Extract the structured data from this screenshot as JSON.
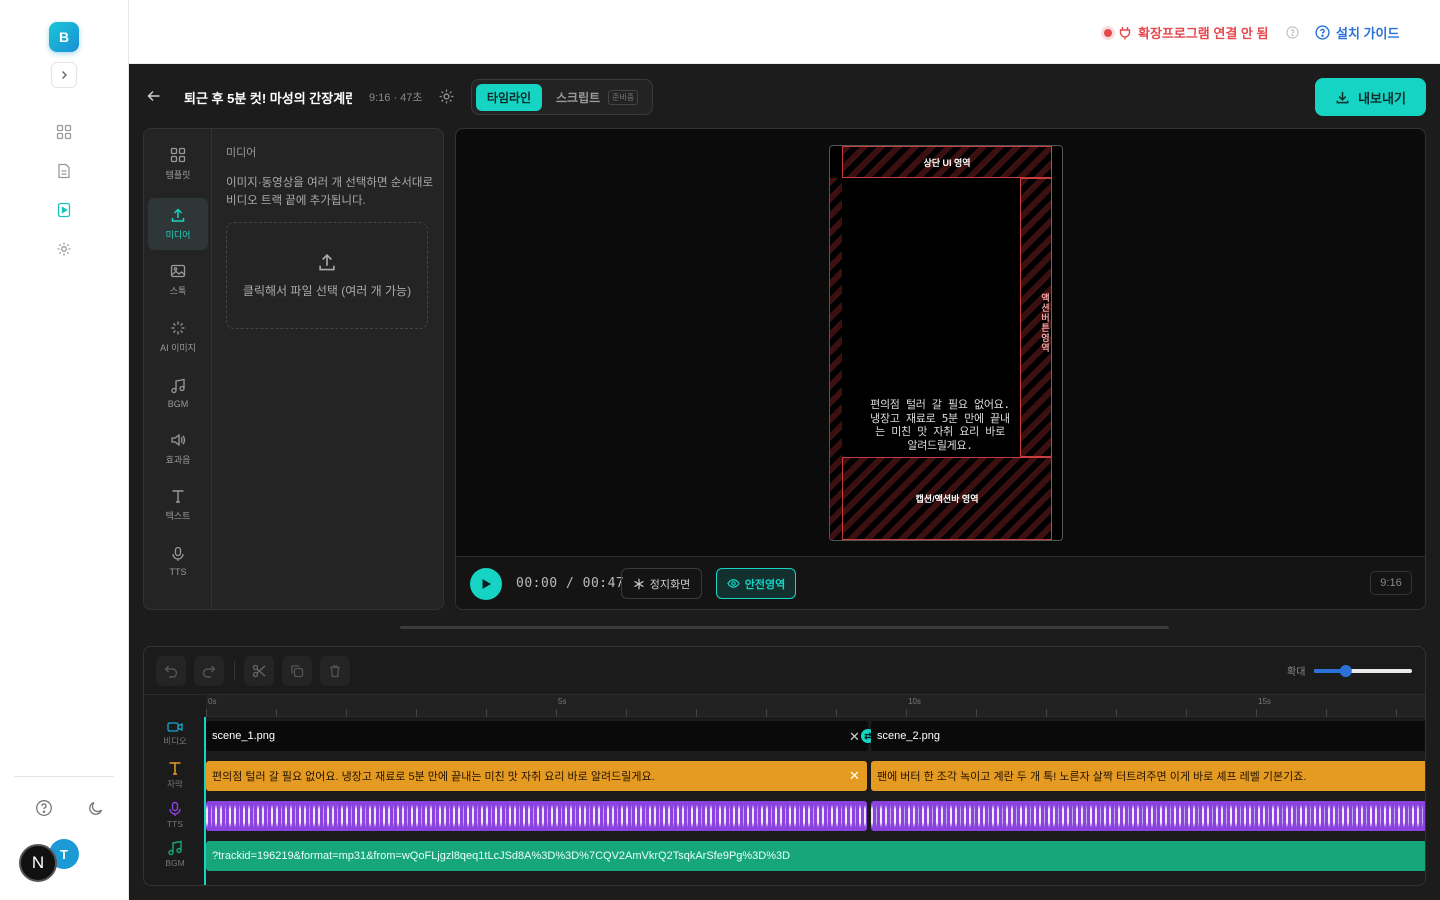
{
  "app": {
    "logo": "B",
    "collapse_icon": "chevron-right-icon"
  },
  "sidebar": {
    "items": [
      {
        "icon": "grid-icon"
      },
      {
        "icon": "document-icon"
      },
      {
        "icon": "video-file-icon",
        "active": true
      },
      {
        "icon": "gear-icon"
      }
    ],
    "help_icon": "help-circle-icon",
    "theme_icon": "moon-icon",
    "avatar_t": "T",
    "avatar_n": "N"
  },
  "topbar": {
    "extension_status": "확장프로그램 연결 안 됨",
    "install_guide": "설치 가이드"
  },
  "header": {
    "title": "퇴근 후 5분 컷! 마성의 간장계란밥",
    "meta": "9:16 · 47초",
    "tabs": {
      "timeline": "타임라인",
      "script": "스크립트",
      "script_badge": "준비중"
    },
    "export": "내보내기"
  },
  "tools": [
    {
      "label": "템플릿",
      "icon": "template-icon"
    },
    {
      "label": "미디어",
      "icon": "upload-icon",
      "active": true
    },
    {
      "label": "스톡",
      "icon": "image-icon"
    },
    {
      "label": "AI 이미지",
      "icon": "sparkle-icon"
    },
    {
      "label": "BGM",
      "icon": "music-icon"
    },
    {
      "label": "효과음",
      "icon": "speaker-icon"
    },
    {
      "label": "텍스트",
      "icon": "text-icon"
    },
    {
      "label": "TTS",
      "icon": "mic-icon"
    }
  ],
  "media": {
    "title": "미디어",
    "description": "이미지·동영상을 여러 개 선택하면 순서대로 비디오 트랙 끝에 추가됩니다.",
    "dropzone": "클릭해서 파일 선택 (여러 개 가능)"
  },
  "preview": {
    "safe_top": "상단 UI 영역",
    "safe_right": "액션버튼영역",
    "safe_bottom": "캡션/액션바 영역",
    "caption": "편의점 털러 갈 필요 없어요. 냉장고 재료로 5분 만에 끝내는 미친 맛 자취 요리 바로 알려드릴게요."
  },
  "controls": {
    "current_time": "00:00",
    "total_time": "00:47",
    "still_label": "정지화면",
    "safe_label": "안전영역",
    "ratio": "9:16"
  },
  "timeline": {
    "zoom_label": "확대",
    "zoom_value": 0.3,
    "ruler": [
      "0s",
      "5s",
      "10s",
      "15s"
    ],
    "tracks": [
      {
        "label": "비디오",
        "icon": "video-icon"
      },
      {
        "label": "자막",
        "icon": "text-icon"
      },
      {
        "label": "TTS",
        "icon": "mic-icon"
      },
      {
        "label": "BGM",
        "icon": "music-icon"
      }
    ],
    "video_clips": [
      "scene_1.png",
      "scene_2.png"
    ],
    "subtitle_clips": [
      "편의점 털러 갈 필요 없어요. 냉장고 재료로 5분 만에 끝내는 미친 맛 자취 요리 바로 알려드릴게요.",
      "팬에 버터 한 조각 녹이고 계란 두 개 톡! 노른자 살짝 터트려주면 이게 바로 셰프 레벨 기본기죠."
    ],
    "bgm_clip": "?trackid=196219&format=mp31&from=wQoFLjgzl8qeq1tLcJSd8A%3D%3D%7CQV2AmVkrQ2TsqkArSfe9Pg%3D%3D"
  },
  "colors": {
    "accent": "#16d4c4",
    "danger": "#e5484d",
    "link": "#2a72d8",
    "subtitle": "#e59b22",
    "tts": "#8b43e0",
    "bgm": "#16a67a"
  }
}
